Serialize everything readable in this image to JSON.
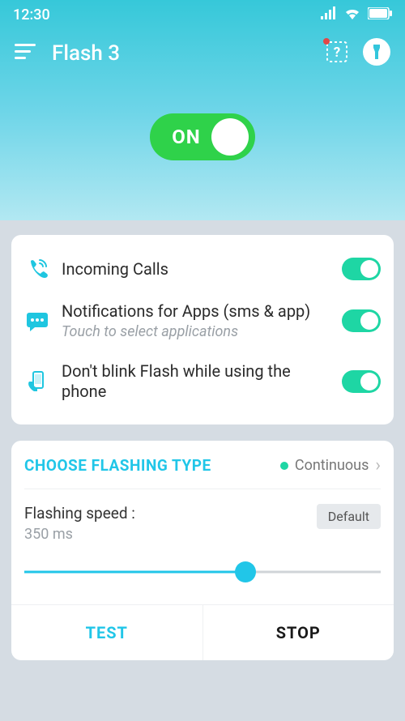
{
  "status": {
    "time": "12:30"
  },
  "app": {
    "title": "Flash 3"
  },
  "mainToggle": {
    "label": "ON"
  },
  "options": [
    {
      "title": "Incoming Calls",
      "sub": "",
      "icon": "phone-ring-icon"
    },
    {
      "title": "Notifications for Apps (sms & app)",
      "sub": "Touch to select applications",
      "icon": "chat-icon"
    },
    {
      "title": "Don't blink Flash while using the phone",
      "sub": "",
      "icon": "phone-hand-icon"
    }
  ],
  "flashingCard": {
    "header": "CHOOSE FLASHING TYPE",
    "type": "Continuous",
    "speedLabel": "Flashing speed :",
    "speedValue": "350 ms",
    "defaultBtn": "Default",
    "testBtn": "TEST",
    "stopBtn": "STOP"
  }
}
